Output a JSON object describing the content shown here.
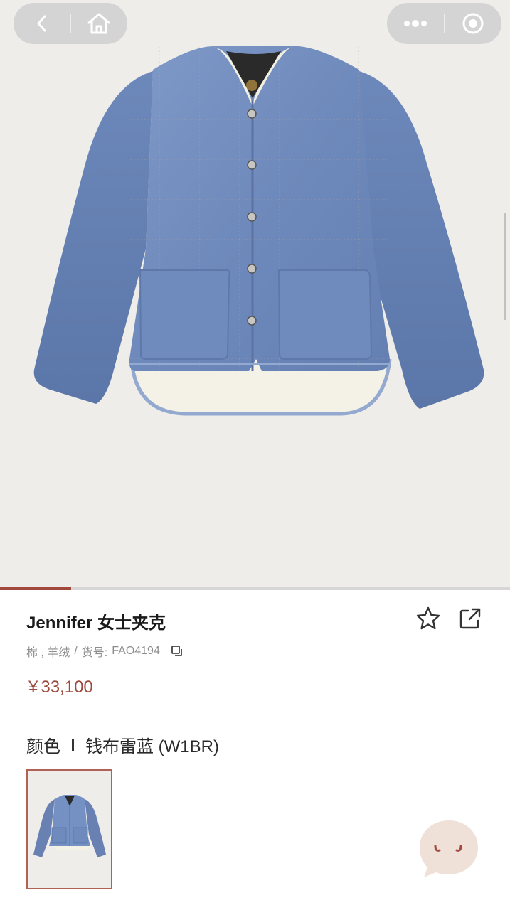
{
  "nav": {
    "back_icon": "chevron-left-icon",
    "home_icon": "home-icon",
    "more_icon": "more-dots-icon",
    "close_icon": "target-circle-icon"
  },
  "gallery": {
    "image_alt": "jacket-photo",
    "progress": 0.14,
    "progress_color": "#a3483c"
  },
  "product": {
    "title": "Jennifer 女士夹克",
    "material": "棉 , 羊绒",
    "sku_label": "货号:",
    "sku": "FAO4194",
    "currency": "¥",
    "price": "33,100",
    "price_color": "#9c4a3f",
    "color_label": "颜色",
    "color_value": "钱布雷蓝 (W1BR)"
  },
  "icons": {
    "favorite": "star-outline-icon",
    "share": "share-external-icon",
    "copy": "copy-icon",
    "chat": "chat-bubble-icon"
  }
}
